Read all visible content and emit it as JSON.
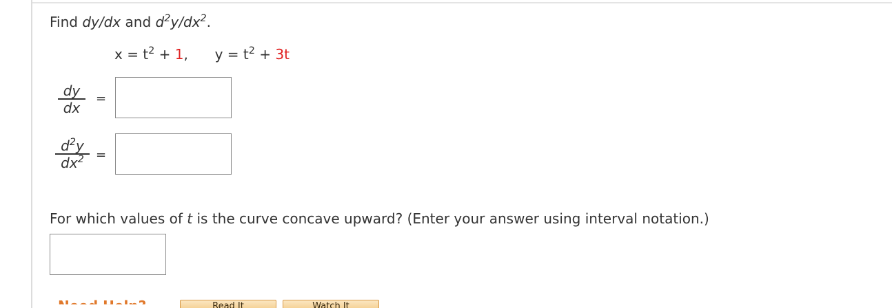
{
  "problem": {
    "prompt_find": "Find",
    "prompt_dydx": "dy/dx",
    "prompt_and": "and",
    "prompt_d2": "d",
    "prompt_sup2a": "2",
    "prompt_y": "y/dx",
    "prompt_sup2b": "2",
    "prompt_period": "."
  },
  "equations": {
    "x_lhs": "x = t",
    "x_exp": "2",
    "x_plus": " + ",
    "x_const": "1",
    "x_comma": ",",
    "y_lhs": "y = t",
    "y_exp": "2",
    "y_plus": " + ",
    "y_term": "3t"
  },
  "first_derivative": {
    "numerator": "dy",
    "denominator": "dx",
    "equals": "=",
    "answer_value": ""
  },
  "second_derivative": {
    "numerator_d": "d",
    "numerator_exp": "2",
    "numerator_y": "y",
    "denominator_dx": "dx",
    "denominator_exp": "2",
    "equals": "=",
    "answer_value": ""
  },
  "concavity": {
    "question_pre": "For which values of ",
    "question_var": "t",
    "question_post": " is the curve concave upward? (Enter your answer using interval notation.)",
    "answer_value": ""
  },
  "help": {
    "label": "Need Help?",
    "button_1": "Read It",
    "button_2": "Watch It"
  },
  "colors": {
    "accent_red": "#e02020",
    "help_orange": "#e0782a"
  }
}
